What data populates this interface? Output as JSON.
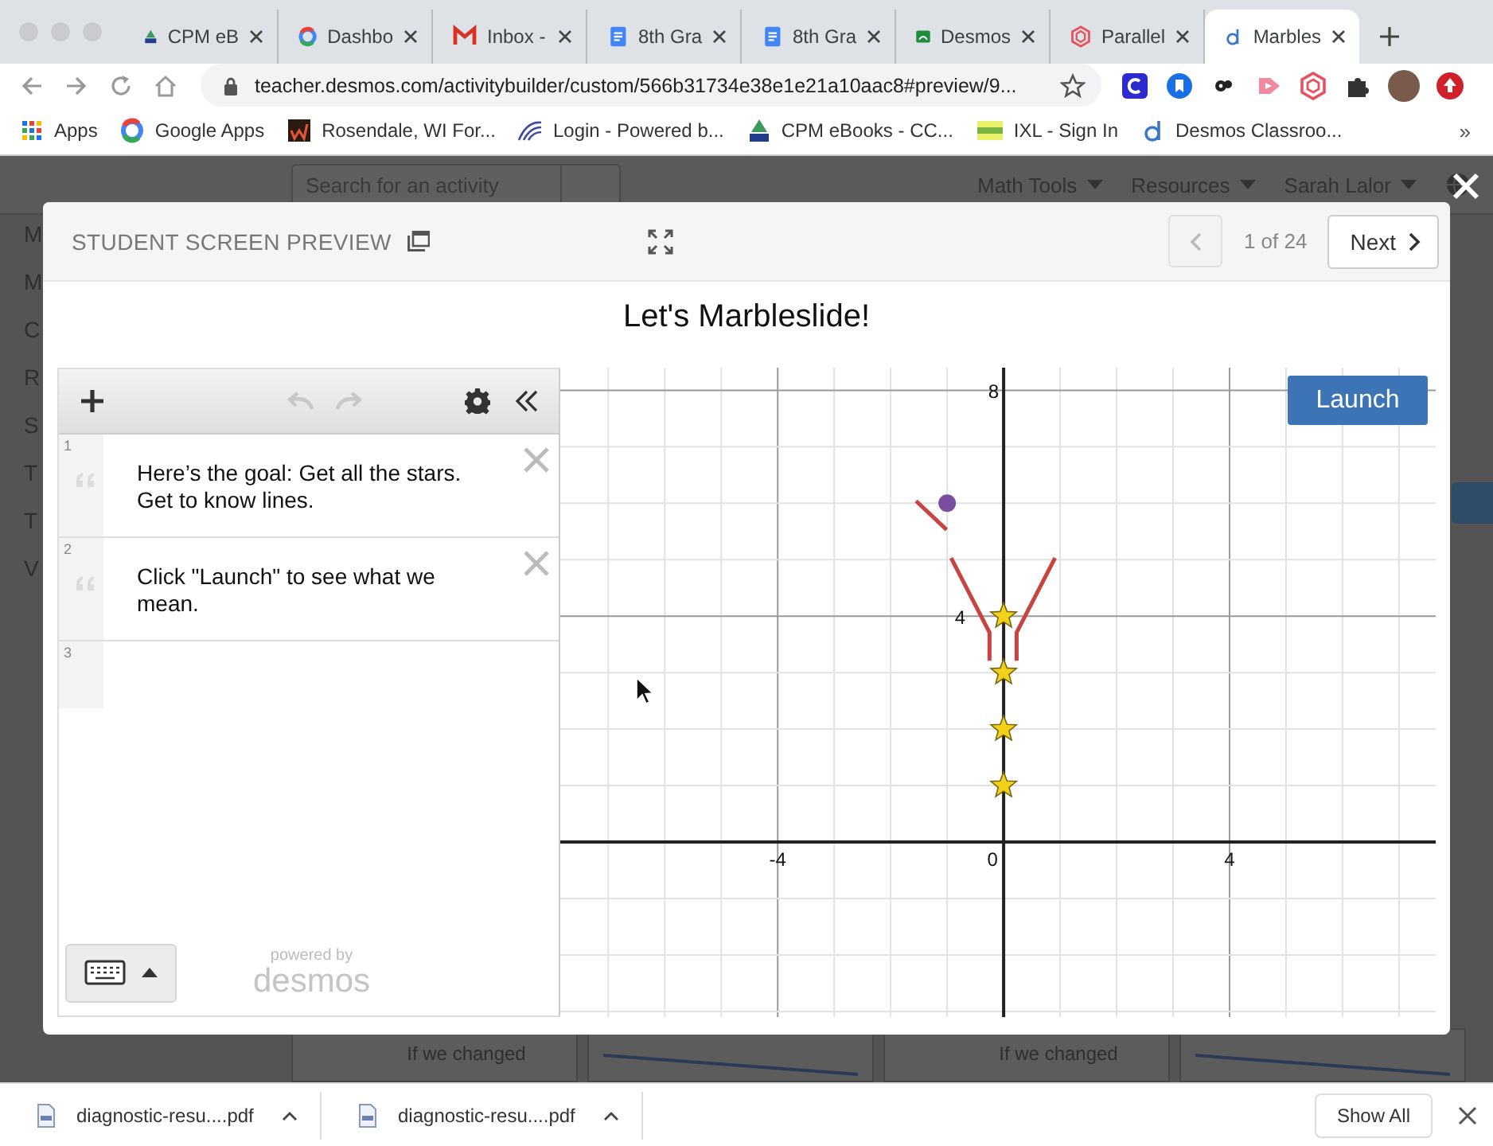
{
  "browser": {
    "tabs": [
      {
        "title": "CPM eB",
        "kind": "cpm",
        "selected": false
      },
      {
        "title": "Dashbo",
        "kind": "google",
        "selected": false
      },
      {
        "title": "Inbox -",
        "kind": "mail",
        "selected": false
      },
      {
        "title": "8th Gra",
        "kind": "doc",
        "selected": false
      },
      {
        "title": "8th Gra",
        "kind": "doc",
        "selected": false
      },
      {
        "title": "Desmos",
        "kind": "classroom",
        "selected": false
      },
      {
        "title": "Parallel",
        "kind": "polygon",
        "selected": false
      },
      {
        "title": "Marbles",
        "kind": "desmos",
        "selected": true
      }
    ],
    "address": "teacher.desmos.com/activitybuilder/custom/566b31734e38e1e21a10aac8#preview/9...",
    "bookmarks": [
      {
        "label": "Apps",
        "kind": "apps"
      },
      {
        "label": "Google Apps",
        "kind": "google"
      },
      {
        "label": "Rosendale, WI For...",
        "kind": "wu"
      },
      {
        "label": "Login - Powered b...",
        "kind": "skt"
      },
      {
        "label": "CPM eBooks - CC...",
        "kind": "cpm"
      },
      {
        "label": "IXL - Sign In",
        "kind": "ixl"
      },
      {
        "label": "Desmos Classroo...",
        "kind": "desmos"
      }
    ],
    "bookmarks_more": "»"
  },
  "background_page": {
    "search": {
      "placeholder": "Search for an activity"
    },
    "menus": [
      "Math Tools",
      "Resources",
      "Sarah Lalor"
    ],
    "sidebar": [
      "M",
      "M",
      "C",
      "R",
      "S",
      "T",
      "T",
      "V"
    ],
    "cards": [
      {
        "kind": "text",
        "text": "If we changed"
      },
      {
        "kind": "graph"
      },
      {
        "kind": "text",
        "text": "If we changed"
      },
      {
        "kind": "graph"
      }
    ]
  },
  "modal": {
    "title": "STUDENT SCREEN PREVIEW",
    "prev_disabled": true,
    "position": "1 of 24",
    "next": "Next",
    "screen_title": "Let's Marbleslide!"
  },
  "calculator": {
    "undo_disabled": true,
    "redo_disabled": true,
    "expressions": [
      {
        "number": "1",
        "kind": "note",
        "text": "Here’s the goal: Get all the stars. Get to know lines."
      },
      {
        "number": "2",
        "kind": "note",
        "text": "Click \"Launch\" to see what we mean."
      },
      {
        "number": "3",
        "kind": "empty"
      }
    ],
    "powered_by": "powered by",
    "brand": "desmos"
  },
  "graph": {
    "launch": "Launch",
    "x_labels": [
      "-4",
      "0",
      "4"
    ],
    "y_labels": [
      "4",
      "8"
    ]
  },
  "downloads": {
    "items": [
      {
        "name": "diagnostic-resu....pdf"
      },
      {
        "name": "diagnostic-resu....pdf"
      }
    ],
    "show_all": "Show All"
  }
}
